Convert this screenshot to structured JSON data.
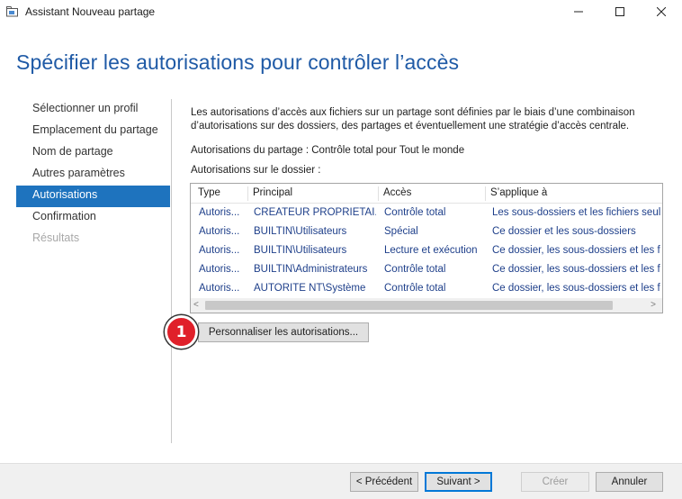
{
  "window": {
    "title": "Assistant Nouveau partage",
    "minimize_glyph": "─",
    "maximize_glyph": "☐",
    "close_glyph": "✕"
  },
  "header": {
    "title": "Spécifier les autorisations pour contrôler l’accès"
  },
  "nav": {
    "items": [
      {
        "label": "Sélectionner un profil",
        "state": "normal"
      },
      {
        "label": "Emplacement du partage",
        "state": "normal"
      },
      {
        "label": "Nom de partage",
        "state": "normal"
      },
      {
        "label": "Autres paramètres",
        "state": "normal"
      },
      {
        "label": "Autorisations",
        "state": "active"
      },
      {
        "label": "Confirmation",
        "state": "normal"
      },
      {
        "label": "Résultats",
        "state": "disabled"
      }
    ]
  },
  "content": {
    "description_line1": "Les autorisations d’accès aux fichiers sur un partage sont définies par le biais d’une combinaison",
    "description_line2": "d’autorisations sur des dossiers, des partages et éventuellement une stratégie d’accès centrale.",
    "share_permissions": "Autorisations du partage : Contrôle total pour Tout le monde",
    "folder_permissions_label": "Autorisations sur le dossier :"
  },
  "table": {
    "columns": [
      "Type",
      "Principal",
      "Accès",
      "S’applique à"
    ],
    "rows": [
      [
        "Autoris...",
        "CREATEUR PROPRIETAI...",
        "Contrôle total",
        "Les sous-dossiers et les fichiers seul"
      ],
      [
        "Autoris...",
        "BUILTIN\\Utilisateurs",
        "Spécial",
        "Ce dossier et les sous-dossiers"
      ],
      [
        "Autoris...",
        "BUILTIN\\Utilisateurs",
        "Lecture et exécution",
        "Ce dossier, les sous-dossiers et les f"
      ],
      [
        "Autoris...",
        "BUILTIN\\Administrateurs",
        "Contrôle total",
        "Ce dossier, les sous-dossiers et les f"
      ],
      [
        "Autoris...",
        "AUTORITE NT\\Système",
        "Contrôle total",
        "Ce dossier, les sous-dossiers et les f"
      ]
    ],
    "scroll_left_glyph": "<",
    "scroll_right_glyph": ">"
  },
  "customize_button": "Personnaliser les autorisations...",
  "annotation_badge": "1",
  "footer": {
    "previous": "< Précédent",
    "next": "Suivant >",
    "create": "Créer",
    "cancel": "Annuler"
  },
  "colors": {
    "accent": "#1e73be",
    "header_title": "#1f5aa6",
    "badge": "#e0202a",
    "table_text": "#1e3f8a"
  }
}
